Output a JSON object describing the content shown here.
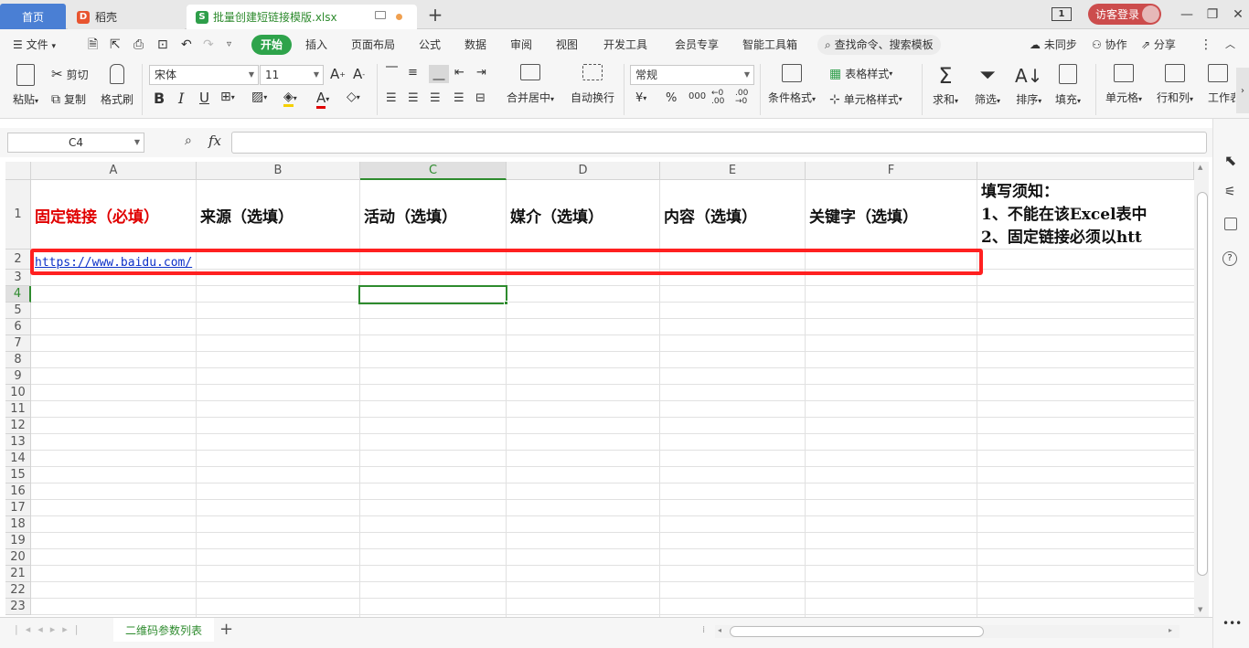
{
  "titlebar": {
    "home_tab": "首页",
    "app_tab": "稻壳",
    "file_tab": "批量创建短链接模版.xlsx",
    "window_badge": "1",
    "visitor_login": "访客登录",
    "add_tab": "+"
  },
  "menu": {
    "file": "文件",
    "items": [
      "开始",
      "插入",
      "页面布局",
      "公式",
      "数据",
      "审阅",
      "视图",
      "开发工具",
      "会员专享",
      "智能工具箱"
    ],
    "search": "查找命令、搜索模板",
    "sync": "未同步",
    "collab": "协作",
    "share": "分享"
  },
  "ribbon": {
    "paste": "粘贴",
    "cut": "剪切",
    "copy": "复制",
    "format_painter": "格式刷",
    "font_name": "宋体",
    "font_size": "11",
    "merge_center": "合并居中",
    "auto_wrap": "自动换行",
    "number_format": "常规",
    "cond_format": "条件格式",
    "table_style": "表格样式",
    "cell_style": "单元格样式",
    "sum": "求和",
    "filter": "筛选",
    "sort": "排序",
    "fill": "填充",
    "cell": "单元格",
    "rows_cols": "行和列",
    "worksheet": "工作表"
  },
  "formula_bar": {
    "name_box": "C4",
    "fx": "fx"
  },
  "sheet": {
    "columns": [
      "A",
      "B",
      "C",
      "D",
      "E",
      "F"
    ],
    "rows": [
      "1",
      "2",
      "3",
      "4",
      "5",
      "6",
      "7",
      "8",
      "9",
      "10",
      "11",
      "12",
      "13",
      "14",
      "15",
      "16",
      "17",
      "18",
      "19",
      "20",
      "21",
      "22",
      "23"
    ],
    "header_cells": [
      "固定链接（必填）",
      "来源（选填）",
      "活动（选填）",
      "媒介（选填）",
      "内容（选填）",
      "关键字（选填）"
    ],
    "notes": [
      "填写须知：",
      "1、不能在该Excel表中",
      "2、固定链接必须以htt"
    ],
    "a2_link": "https://www.baidu.com/",
    "selected_cell": "C4",
    "tab_name": "二维码参数列表",
    "colors": {
      "required_header": "#e00000",
      "highlight_box": "#ff2020",
      "selection": "#2e8b2e"
    }
  }
}
